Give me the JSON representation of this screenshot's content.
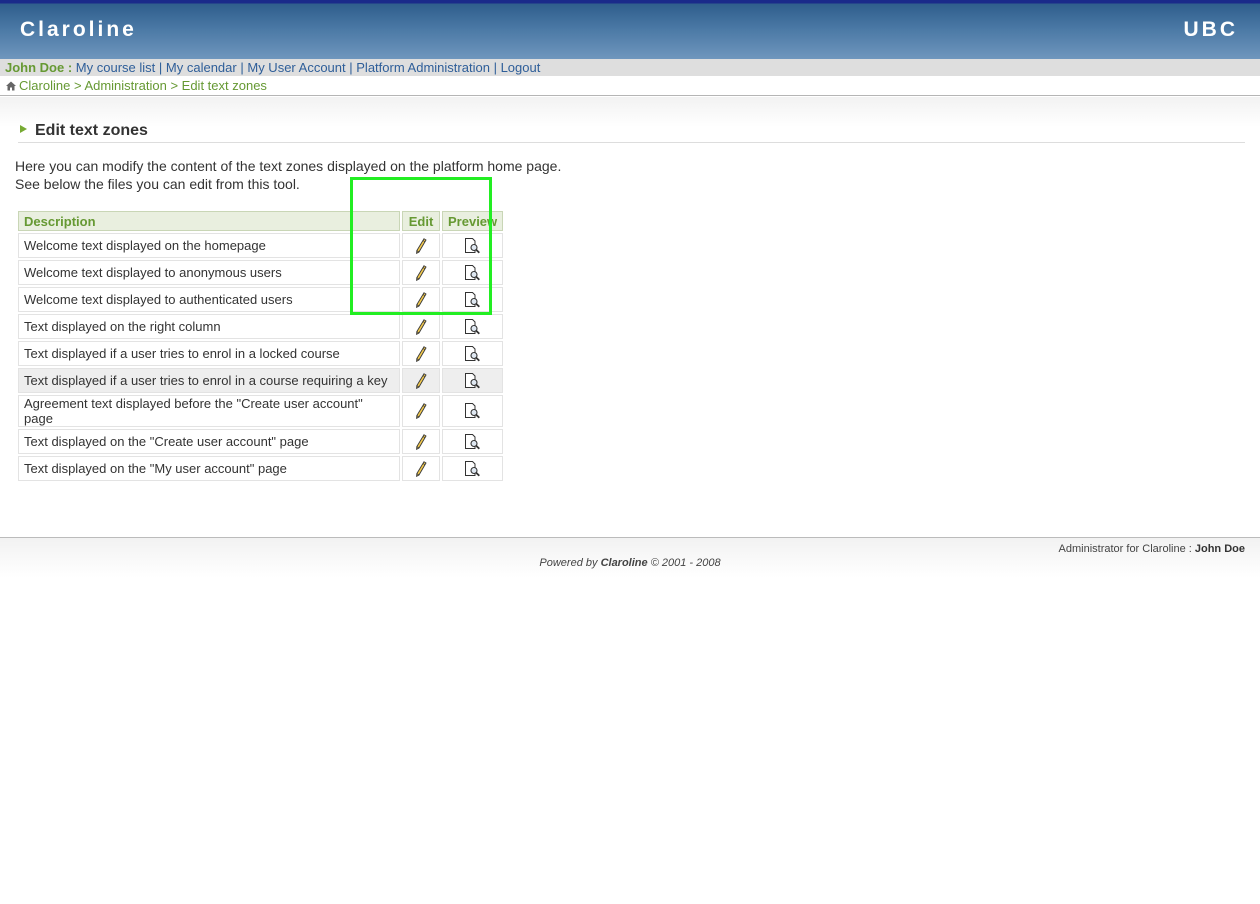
{
  "header": {
    "brand": "Claroline",
    "institution": "UBC"
  },
  "userbar": {
    "user": "John Doe :",
    "links": [
      "My course list",
      "My calendar",
      "My User Account",
      "Platform Administration",
      "Logout"
    ],
    "separator": "|"
  },
  "breadcrumbs": {
    "items": [
      "Claroline",
      "Administration",
      "Edit text zones"
    ],
    "separator": ">"
  },
  "page": {
    "title": "Edit text zones",
    "intro_line1": "Here you can modify the content of the text zones displayed on the platform home page.",
    "intro_line2": "See below the files you can edit from this tool."
  },
  "table": {
    "headers": {
      "description": "Description",
      "edit": "Edit",
      "preview": "Preview"
    },
    "rows": [
      "Welcome text displayed on the homepage",
      "Welcome text displayed to anonymous users",
      "Welcome text displayed to authenticated users",
      "Text displayed on the right column",
      "Text displayed if a user tries to enrol in a locked course",
      "Text displayed if a user tries to enrol in a course requiring a key",
      "Agreement text displayed before the \"Create user account\" page",
      "Text displayed on the \"Create user account\" page",
      "Text displayed on the \"My user account\" page"
    ],
    "edit_icon": "pencil-icon",
    "preview_icon": "document-magnifier-icon"
  },
  "footer": {
    "admin_prefix": "Administrator for Claroline :",
    "admin_name": "John Doe",
    "powered_prefix": "Powered by",
    "powered_brand": "Claroline",
    "powered_suffix": "© 2001 - 2008"
  },
  "colors": {
    "accent_green": "#669933",
    "link_blue": "#2e5e99",
    "highlight_box": "#22ee22"
  }
}
